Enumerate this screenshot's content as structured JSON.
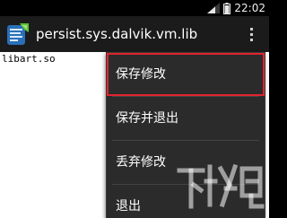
{
  "status_bar": {
    "time": "22:02",
    "icons": [
      "signal-icon",
      "battery-icon"
    ]
  },
  "action_bar": {
    "app_icon": "app-icon",
    "title": "persist.sys.dalvik.vm.lib",
    "overflow_icon": "overflow-menu-icon"
  },
  "editor": {
    "content": "libart.so"
  },
  "menu": {
    "items": [
      {
        "label": "保存修改",
        "highlighted": true
      },
      {
        "label": "保存并退出",
        "highlighted": false
      },
      {
        "label": "丢弃修改",
        "highlighted": false
      },
      {
        "label": "退出",
        "highlighted": false
      }
    ]
  },
  "colors": {
    "highlight": "#e1232e",
    "menu_bg": "#2b2b2b",
    "action_bar_bg": "#1b1b1b"
  },
  "watermark": {
    "text": "下载吧"
  }
}
